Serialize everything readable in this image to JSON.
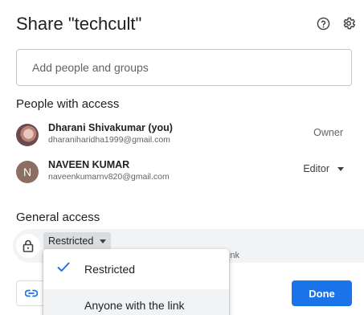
{
  "dialog": {
    "title": "Share \"techcult\""
  },
  "header_icons": [
    "help-icon",
    "settings-gear-icon"
  ],
  "add_people": {
    "placeholder": "Add people and groups"
  },
  "people_section": {
    "title": "People with access"
  },
  "people": [
    {
      "name": "Dharani Shivakumar (you)",
      "email": "dharaniharidha1999@gmail.com",
      "role": "Owner"
    },
    {
      "name": "NAVEEN KUMAR",
      "email": "naveenkumarnv820@gmail.com",
      "role": "Editor",
      "avatar_letter": "N"
    }
  ],
  "general_access": {
    "title": "General access",
    "selected": "Restricted",
    "description_partial": "nk"
  },
  "access_menu": {
    "options": [
      {
        "label": "Restricted",
        "checked": true
      },
      {
        "label": "Anyone with the link",
        "checked": false
      }
    ]
  },
  "footer": {
    "done_label": "Done"
  },
  "colors": {
    "primary": "#1a73e8",
    "text": "#202124",
    "muted": "#5f6368"
  }
}
